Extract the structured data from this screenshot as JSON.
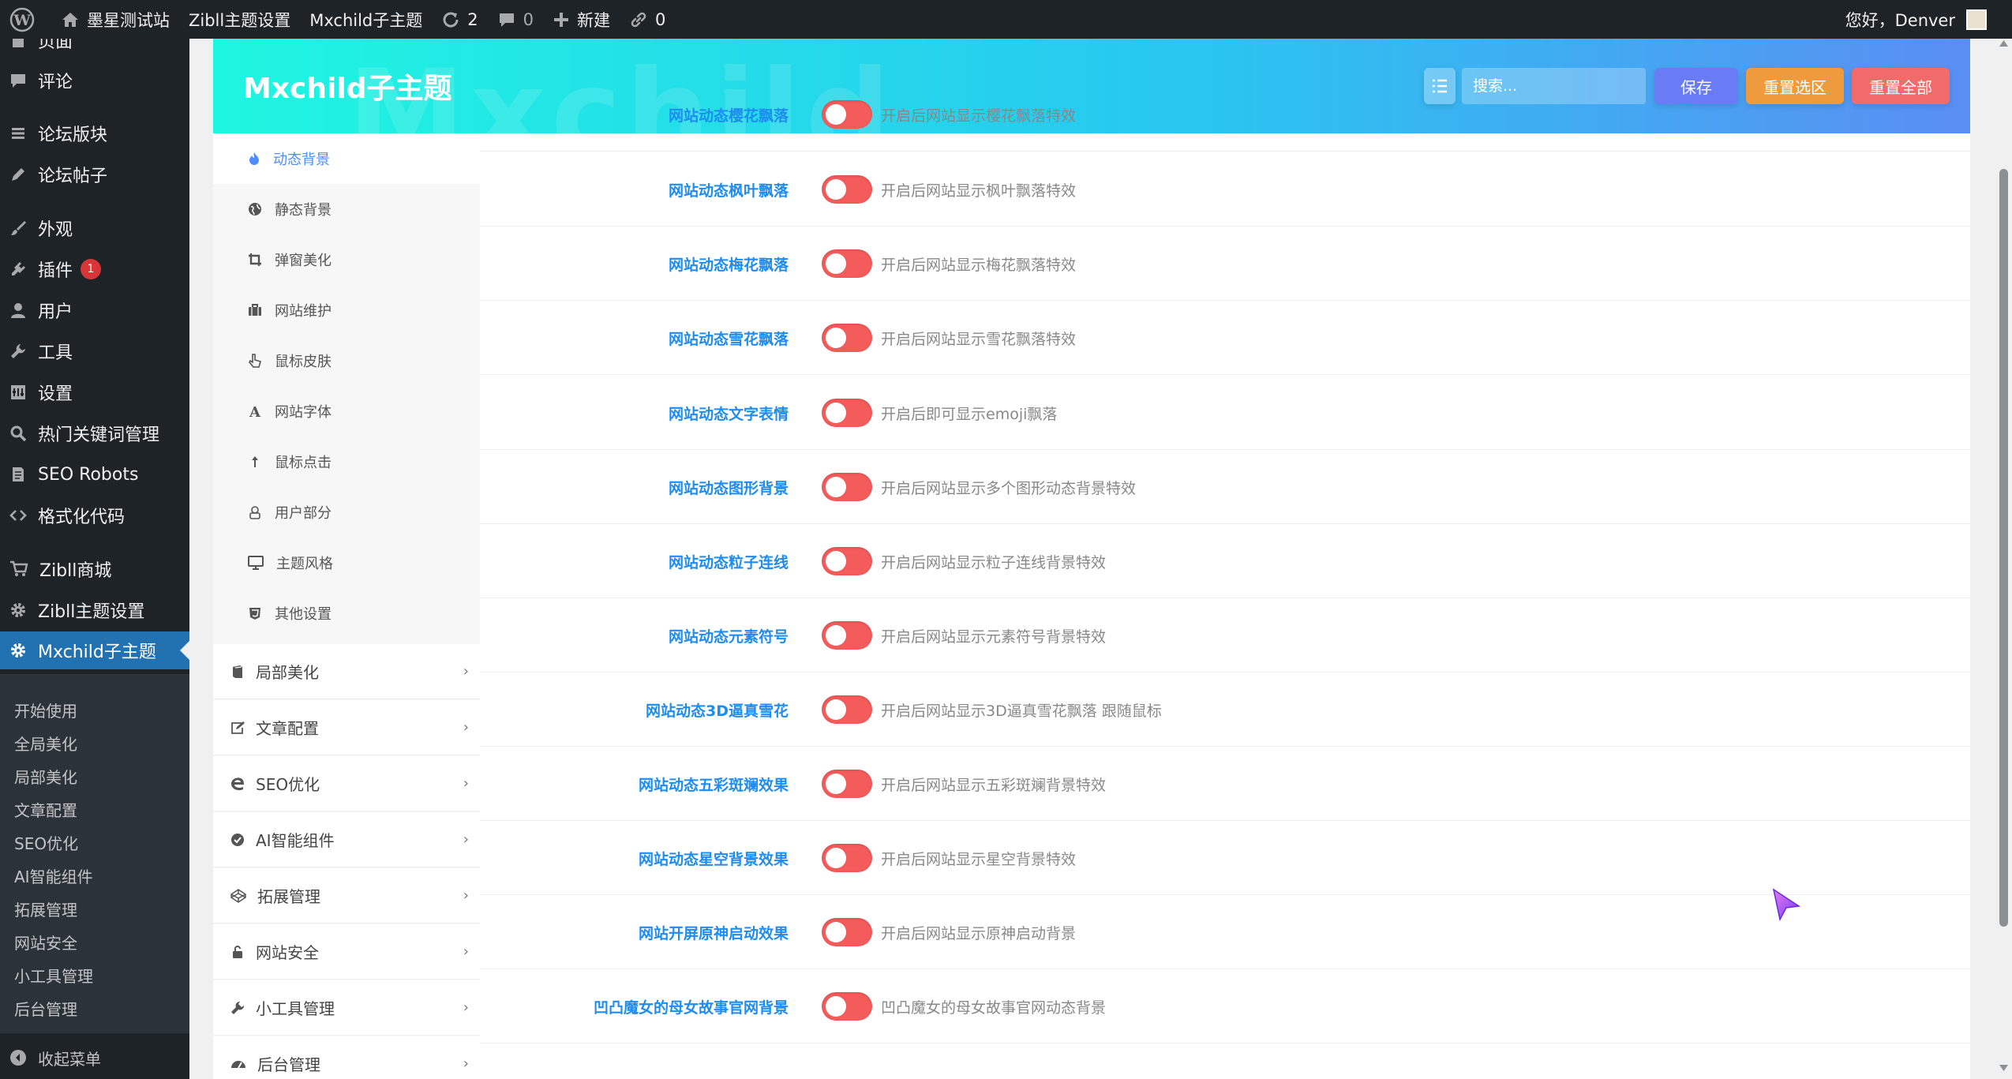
{
  "adminbar": {
    "site_name": "墨星测试站",
    "zibll_settings": "Zibll主题设置",
    "mxchild": "Mxchild子主题",
    "updates": "2",
    "comments": "0",
    "new_label": "新建",
    "links": "0",
    "greeting": "您好，Denver"
  },
  "sidebar": {
    "items": [
      {
        "label": "页面",
        "icon": "page-icon"
      },
      {
        "label": "评论",
        "icon": "comment-icon"
      },
      {
        "label": "论坛版块",
        "icon": "stack-icon"
      },
      {
        "label": "论坛帖子",
        "icon": "pen-icon"
      },
      {
        "label": "外观",
        "icon": "brush-icon"
      },
      {
        "label": "插件",
        "icon": "plugin-icon",
        "badge": "1"
      },
      {
        "label": "用户",
        "icon": "user-icon"
      },
      {
        "label": "工具",
        "icon": "wrench-icon"
      },
      {
        "label": "设置",
        "icon": "settings-icon"
      },
      {
        "label": "热门关键词管理",
        "icon": "search-icon"
      },
      {
        "label": "SEO Robots",
        "icon": "document-icon"
      },
      {
        "label": "格式化代码",
        "icon": "code-icon"
      },
      {
        "label": "Zibll商城",
        "icon": "cart-icon"
      },
      {
        "label": "Zibll主题设置",
        "icon": "gear-icon"
      },
      {
        "label": "Mxchild子主题",
        "icon": "gear-icon"
      }
    ],
    "submenu": [
      "开始使用",
      "全局美化",
      "局部美化",
      "文章配置",
      "SEO优化",
      "AI智能组件",
      "拓展管理",
      "网站安全",
      "小工具管理",
      "后台管理"
    ],
    "collapse_label": "收起菜单"
  },
  "header": {
    "title": "Mxchild子主题",
    "watermark": "Mxchild",
    "search_placeholder": "搜索...",
    "save_label": "保存",
    "reset_section_label": "重置选区",
    "reset_all_label": "重置全部",
    "colors": {
      "save": "#6a7cf5",
      "reset_section": "#f09a3e",
      "reset_all": "#f26b6b"
    }
  },
  "nav": {
    "subs": [
      {
        "label": "动态背景",
        "icon": "fire-icon",
        "active": true
      },
      {
        "label": "静态背景",
        "icon": "globe-icon"
      },
      {
        "label": "弹窗美化",
        "icon": "crop-icon"
      },
      {
        "label": "网站维护",
        "icon": "briefcase-icon"
      },
      {
        "label": "鼠标皮肤",
        "icon": "pointer-icon"
      },
      {
        "label": "网站字体",
        "icon": "font-icon"
      },
      {
        "label": "鼠标点击",
        "icon": "click-icon"
      },
      {
        "label": "用户部分",
        "icon": "user-icon"
      },
      {
        "label": "主题风格",
        "icon": "monitor-icon"
      },
      {
        "label": "其他设置",
        "icon": "css-icon"
      }
    ],
    "groups": [
      {
        "label": "局部美化",
        "icon": "book-icon"
      },
      {
        "label": "文章配置",
        "icon": "edit-icon"
      },
      {
        "label": "SEO优化",
        "icon": "edge-icon"
      },
      {
        "label": "AI智能组件",
        "icon": "check-circle-icon"
      },
      {
        "label": "拓展管理",
        "icon": "codepen-icon"
      },
      {
        "label": "网站安全",
        "icon": "lock-icon"
      },
      {
        "label": "小工具管理",
        "icon": "wrench-icon"
      },
      {
        "label": "后台管理",
        "icon": "dashboard-icon"
      }
    ]
  },
  "options": [
    {
      "title": "网站动态樱花飘落",
      "desc": "开启后网站显示樱花飘落特效"
    },
    {
      "title": "网站动态枫叶飘落",
      "desc": "开启后网站显示枫叶飘落特效"
    },
    {
      "title": "网站动态梅花飘落",
      "desc": "开启后网站显示梅花飘落特效"
    },
    {
      "title": "网站动态雪花飘落",
      "desc": "开启后网站显示雪花飘落特效"
    },
    {
      "title": "网站动态文字表情",
      "desc": "开启后即可显示emoji飘落"
    },
    {
      "title": "网站动态图形背景",
      "desc": "开启后网站显示多个图形动态背景特效"
    },
    {
      "title": "网站动态粒子连线",
      "desc": "开启后网站显示粒子连线背景特效"
    },
    {
      "title": "网站动态元素符号",
      "desc": "开启后网站显示元素符号背景特效"
    },
    {
      "title": "网站动态3D逼真雪花",
      "desc": "开启后网站显示3D逼真雪花飘落 跟随鼠标"
    },
    {
      "title": "网站动态五彩斑斓效果",
      "desc": "开启后网站显示五彩斑斓背景特效"
    },
    {
      "title": "网站动态星空背景效果",
      "desc": "开启后网站显示星空背景特效"
    },
    {
      "title": "网站开屏原神启动效果",
      "desc": "开启后网站显示原神启动背景"
    },
    {
      "title": "凹凸魔女的母女故事官网背景",
      "desc": "凹凸魔女的母女故事官网动态背景"
    }
  ],
  "colors": {
    "accent": "#1e8cf0",
    "toggle": "#f45c5c",
    "admin_dark": "#1d2327",
    "wp_blue": "#2271b1"
  }
}
